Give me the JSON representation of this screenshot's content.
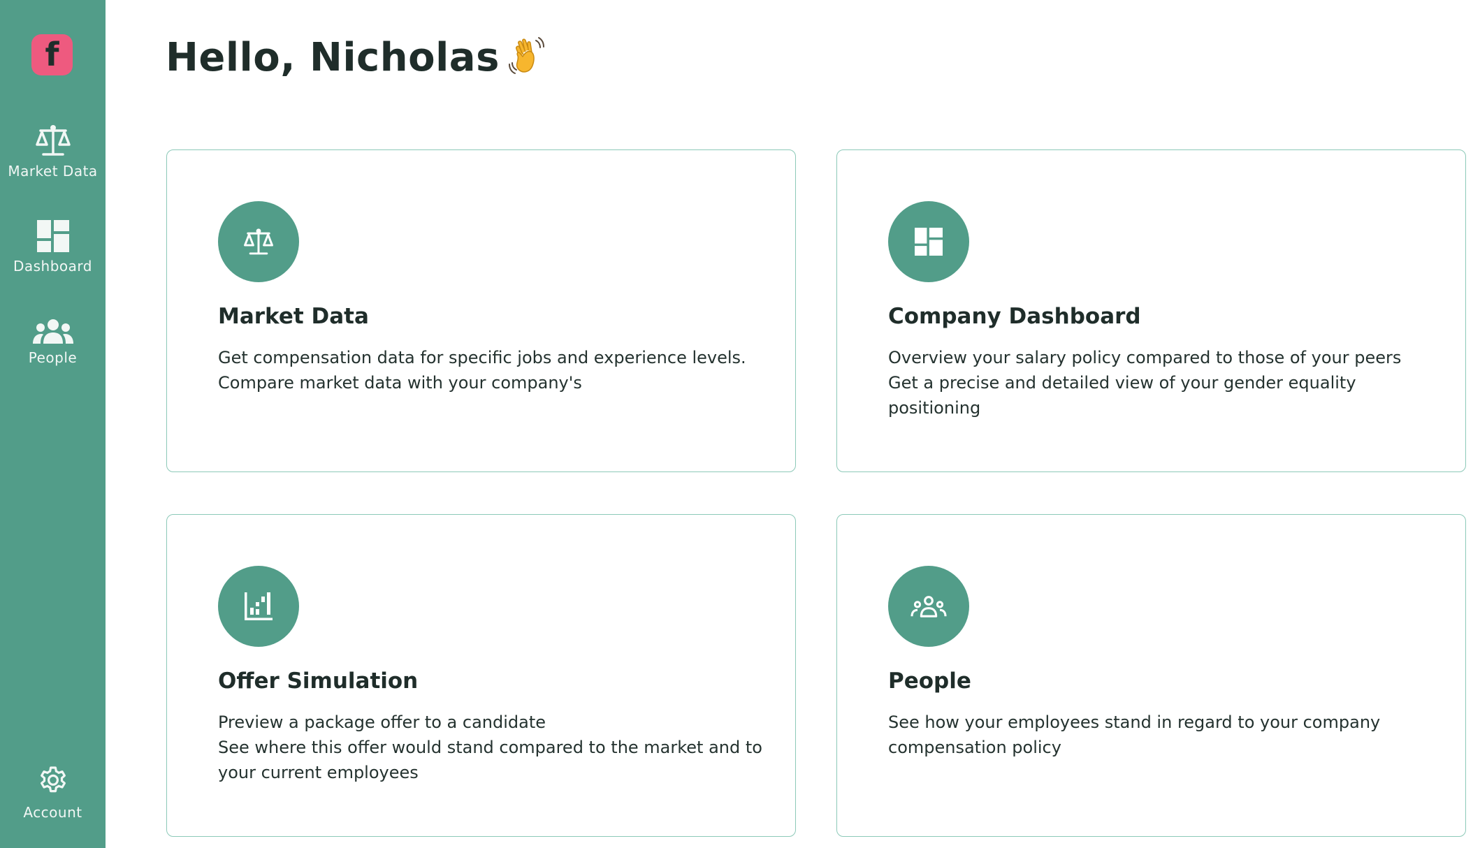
{
  "sidebar": {
    "logo_letter": "f",
    "items": [
      {
        "label": "Market Data",
        "icon": "scales-icon"
      },
      {
        "label": "Dashboard",
        "icon": "dashboard-icon"
      },
      {
        "label": "People",
        "icon": "people-icon"
      }
    ],
    "account": {
      "label": "Account",
      "icon": "gear-icon"
    }
  },
  "header": {
    "greeting": "Hello, Nicholas",
    "emoji_icon": "waving-hand-icon"
  },
  "cards": [
    {
      "title": "Market Data",
      "icon": "scales-icon",
      "lines": [
        "Get compensation data for specific jobs and experience levels.",
        "Compare market data with your company's"
      ]
    },
    {
      "title": "Company Dashboard",
      "icon": "dashboard-icon",
      "lines": [
        "Overview your salary policy compared to those of your peers",
        "Get a precise and detailed view of your gender equality positioning"
      ]
    },
    {
      "title": "Offer Simulation",
      "icon": "bar-chart-icon",
      "lines": [
        "Preview a package offer to a candidate",
        "See where this offer would stand compared to the market and to your current employees"
      ]
    },
    {
      "title": "People",
      "icon": "people-icon",
      "lines": [
        "See how your employees stand in regard to your company compensation policy"
      ]
    }
  ],
  "colors": {
    "sidebar_bg": "#529d89",
    "accent": "#529d89",
    "logo_bg": "#ee5a7f",
    "card_border": "#8cc9b8",
    "text_dark": "#1f2d2a"
  }
}
